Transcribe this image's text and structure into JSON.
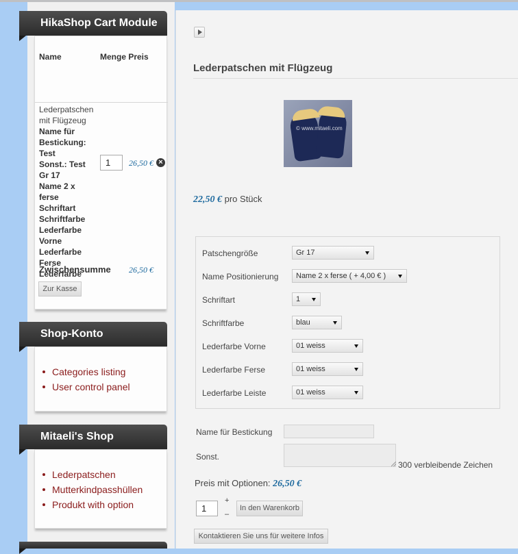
{
  "cart_module": {
    "title": "HikaShop Cart Module",
    "col_name": "Name",
    "col_qty_price": "Menge Preis",
    "item": {
      "name_line1": "Lederpatschen",
      "name_line2": "mit Flügzeug",
      "details": [
        "Name für",
        "Bestickung:",
        "Test",
        "Sonst.: Test",
        "Gr 17",
        "Name 2 x",
        "ferse",
        "Schriftart",
        "Schriftfarbe",
        "Lederfarbe",
        "Vorne",
        "Lederfarbe",
        "Ferse",
        "Lederfarbe",
        "Leiste"
      ],
      "quantity": "1",
      "price": "26,50 €"
    },
    "subtotal_label": "Zwischensumme",
    "subtotal_price": "26,50 €",
    "checkout_button": "Zur Kasse"
  },
  "account_module": {
    "title": "Shop-Konto",
    "links": [
      "Categories listing",
      "User control panel"
    ]
  },
  "shop_module": {
    "title": "Mitaeli's Shop",
    "links": [
      "Lederpatschen",
      "Mutterkindpasshüllen",
      "Produkt with option"
    ]
  },
  "product": {
    "title": "Lederpatschen mit Flügzeug",
    "image_watermark": "© www.mitaeli.com",
    "price": "22,50 €",
    "price_unit": "pro Stück",
    "options": [
      {
        "label": "Patschengröße",
        "value": "Gr 17"
      },
      {
        "label": "Name Positionierung",
        "value": "Name 2 x ferse ( + 4,00 € )"
      },
      {
        "label": "Schriftart",
        "value": "1"
      },
      {
        "label": "Schriftfarbe",
        "value": "blau"
      },
      {
        "label": "Lederfarbe Vorne",
        "value": "01 weiss"
      },
      {
        "label": "Lederfarbe Ferse",
        "value": "01 weiss"
      },
      {
        "label": "Lederfarbe Leiste",
        "value": "01 weiss"
      }
    ],
    "embroidery_label": "Name für Bestickung",
    "embroidery_value": "",
    "other_label": "Sonst.",
    "other_value": "",
    "remaining_chars": "300 verbleibende Zeichen",
    "options_price_label": "Preis mit Optionen:",
    "options_price": "26,50 €",
    "quantity": "1",
    "plus": "+",
    "minus": "–",
    "add_to_cart": "In den Warenkorb",
    "contact_button": "Kontaktieren Sie uns für weitere Infos"
  },
  "colors": {
    "page_background": "#a9cdf4",
    "module_header": "#3a3a3a",
    "link": "#8a1b1b",
    "price": "#1e6a9e"
  },
  "icons": {
    "remove": "x-circle-icon",
    "toggle": "triangle-right-icon"
  }
}
